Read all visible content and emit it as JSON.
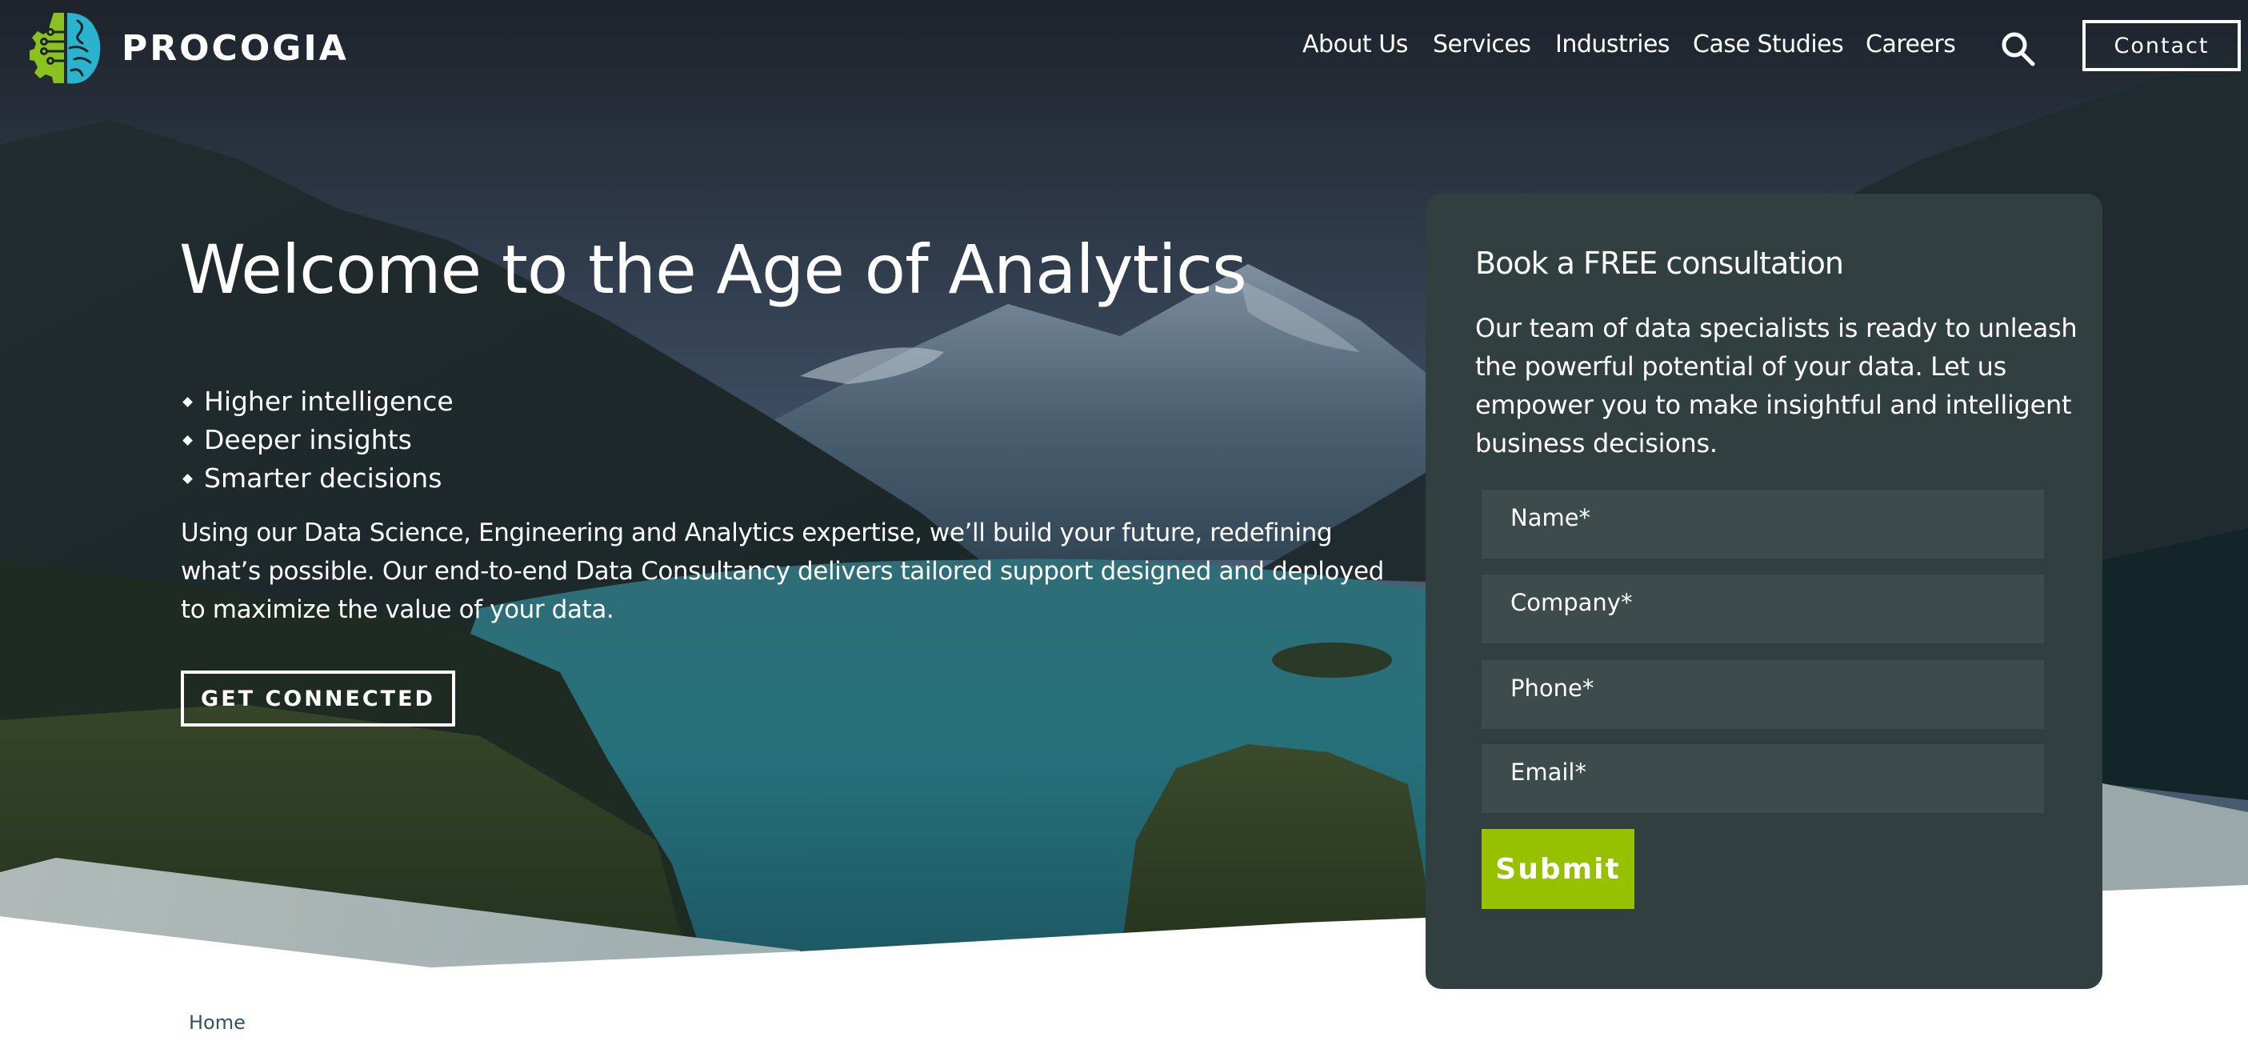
{
  "header": {
    "brand_name": "PROCOGIA",
    "logo_icon": "gear-brain-logo-icon",
    "nav": [
      {
        "label": "About Us"
      },
      {
        "label": "Services"
      },
      {
        "label": "Industries"
      },
      {
        "label": "Case Studies"
      },
      {
        "label": "Careers"
      }
    ],
    "search_icon": "search-icon",
    "contact_label": "Contact"
  },
  "hero": {
    "title": "Welcome to the Age of Analytics",
    "bullets": [
      "Higher intelligence",
      "Deeper insights",
      "Smarter decisions"
    ],
    "paragraph": "Using our Data Science, Engineering and Analytics expertise, we’ll build your future, redefining what’s possible. Our end-to-end Data Consultancy delivers tailored support designed and deployed to maximize the value of your data.",
    "cta_label": "GET CONNECTED"
  },
  "consultation_form": {
    "title": "Book a FREE consultation",
    "description": "Our team of data specialists is ready to unleash the powerful potential of your data. Let us empower you to make insightful and intelligent business decisions.",
    "fields": [
      {
        "placeholder": "Name*",
        "value": ""
      },
      {
        "placeholder": "Company*",
        "value": ""
      },
      {
        "placeholder": "Phone*",
        "value": ""
      },
      {
        "placeholder": "Email*",
        "value": ""
      }
    ],
    "submit_label": "Submit"
  },
  "breadcrumb": {
    "items": [
      {
        "label": "Home"
      }
    ]
  },
  "colors": {
    "accent_green": "#96c000",
    "logo_green": "#8cc21f",
    "logo_cyan": "#2ab3cf",
    "card_bg": "#323f40",
    "field_bg": "#3d4b4c",
    "breadcrumb_text": "#2e5566"
  }
}
